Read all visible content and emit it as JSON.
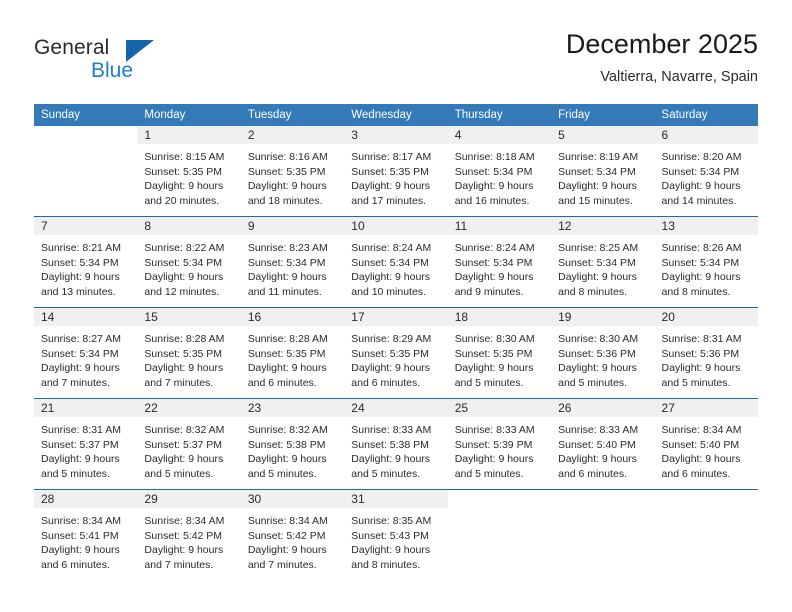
{
  "brand": {
    "name_part1": "General",
    "name_part2": "Blue",
    "logo_icon": "triangle-icon"
  },
  "header": {
    "title": "December 2025",
    "subtitle": "Valtierra, Navarre, Spain"
  },
  "colors": {
    "header_blue": "#3479b8",
    "separator_blue": "#1f69ad",
    "daynum_band": "#f0f0f0",
    "brand_blue": "#1a7fd4",
    "logo_blue": "#1465ab"
  },
  "weekday_headers": [
    "Sunday",
    "Monday",
    "Tuesday",
    "Wednesday",
    "Thursday",
    "Friday",
    "Saturday"
  ],
  "weeks": [
    [
      {
        "day": "",
        "lines": []
      },
      {
        "day": "1",
        "lines": [
          "Sunrise: 8:15 AM",
          "Sunset: 5:35 PM",
          "Daylight: 9 hours",
          "and 20 minutes."
        ]
      },
      {
        "day": "2",
        "lines": [
          "Sunrise: 8:16 AM",
          "Sunset: 5:35 PM",
          "Daylight: 9 hours",
          "and 18 minutes."
        ]
      },
      {
        "day": "3",
        "lines": [
          "Sunrise: 8:17 AM",
          "Sunset: 5:35 PM",
          "Daylight: 9 hours",
          "and 17 minutes."
        ]
      },
      {
        "day": "4",
        "lines": [
          "Sunrise: 8:18 AM",
          "Sunset: 5:34 PM",
          "Daylight: 9 hours",
          "and 16 minutes."
        ]
      },
      {
        "day": "5",
        "lines": [
          "Sunrise: 8:19 AM",
          "Sunset: 5:34 PM",
          "Daylight: 9 hours",
          "and 15 minutes."
        ]
      },
      {
        "day": "6",
        "lines": [
          "Sunrise: 8:20 AM",
          "Sunset: 5:34 PM",
          "Daylight: 9 hours",
          "and 14 minutes."
        ]
      }
    ],
    [
      {
        "day": "7",
        "lines": [
          "Sunrise: 8:21 AM",
          "Sunset: 5:34 PM",
          "Daylight: 9 hours",
          "and 13 minutes."
        ]
      },
      {
        "day": "8",
        "lines": [
          "Sunrise: 8:22 AM",
          "Sunset: 5:34 PM",
          "Daylight: 9 hours",
          "and 12 minutes."
        ]
      },
      {
        "day": "9",
        "lines": [
          "Sunrise: 8:23 AM",
          "Sunset: 5:34 PM",
          "Daylight: 9 hours",
          "and 11 minutes."
        ]
      },
      {
        "day": "10",
        "lines": [
          "Sunrise: 8:24 AM",
          "Sunset: 5:34 PM",
          "Daylight: 9 hours",
          "and 10 minutes."
        ]
      },
      {
        "day": "11",
        "lines": [
          "Sunrise: 8:24 AM",
          "Sunset: 5:34 PM",
          "Daylight: 9 hours",
          "and 9 minutes."
        ]
      },
      {
        "day": "12",
        "lines": [
          "Sunrise: 8:25 AM",
          "Sunset: 5:34 PM",
          "Daylight: 9 hours",
          "and 8 minutes."
        ]
      },
      {
        "day": "13",
        "lines": [
          "Sunrise: 8:26 AM",
          "Sunset: 5:34 PM",
          "Daylight: 9 hours",
          "and 8 minutes."
        ]
      }
    ],
    [
      {
        "day": "14",
        "lines": [
          "Sunrise: 8:27 AM",
          "Sunset: 5:34 PM",
          "Daylight: 9 hours",
          "and 7 minutes."
        ]
      },
      {
        "day": "15",
        "lines": [
          "Sunrise: 8:28 AM",
          "Sunset: 5:35 PM",
          "Daylight: 9 hours",
          "and 7 minutes."
        ]
      },
      {
        "day": "16",
        "lines": [
          "Sunrise: 8:28 AM",
          "Sunset: 5:35 PM",
          "Daylight: 9 hours",
          "and 6 minutes."
        ]
      },
      {
        "day": "17",
        "lines": [
          "Sunrise: 8:29 AM",
          "Sunset: 5:35 PM",
          "Daylight: 9 hours",
          "and 6 minutes."
        ]
      },
      {
        "day": "18",
        "lines": [
          "Sunrise: 8:30 AM",
          "Sunset: 5:35 PM",
          "Daylight: 9 hours",
          "and 5 minutes."
        ]
      },
      {
        "day": "19",
        "lines": [
          "Sunrise: 8:30 AM",
          "Sunset: 5:36 PM",
          "Daylight: 9 hours",
          "and 5 minutes."
        ]
      },
      {
        "day": "20",
        "lines": [
          "Sunrise: 8:31 AM",
          "Sunset: 5:36 PM",
          "Daylight: 9 hours",
          "and 5 minutes."
        ]
      }
    ],
    [
      {
        "day": "21",
        "lines": [
          "Sunrise: 8:31 AM",
          "Sunset: 5:37 PM",
          "Daylight: 9 hours",
          "and 5 minutes."
        ]
      },
      {
        "day": "22",
        "lines": [
          "Sunrise: 8:32 AM",
          "Sunset: 5:37 PM",
          "Daylight: 9 hours",
          "and 5 minutes."
        ]
      },
      {
        "day": "23",
        "lines": [
          "Sunrise: 8:32 AM",
          "Sunset: 5:38 PM",
          "Daylight: 9 hours",
          "and 5 minutes."
        ]
      },
      {
        "day": "24",
        "lines": [
          "Sunrise: 8:33 AM",
          "Sunset: 5:38 PM",
          "Daylight: 9 hours",
          "and 5 minutes."
        ]
      },
      {
        "day": "25",
        "lines": [
          "Sunrise: 8:33 AM",
          "Sunset: 5:39 PM",
          "Daylight: 9 hours",
          "and 5 minutes."
        ]
      },
      {
        "day": "26",
        "lines": [
          "Sunrise: 8:33 AM",
          "Sunset: 5:40 PM",
          "Daylight: 9 hours",
          "and 6 minutes."
        ]
      },
      {
        "day": "27",
        "lines": [
          "Sunrise: 8:34 AM",
          "Sunset: 5:40 PM",
          "Daylight: 9 hours",
          "and 6 minutes."
        ]
      }
    ],
    [
      {
        "day": "28",
        "lines": [
          "Sunrise: 8:34 AM",
          "Sunset: 5:41 PM",
          "Daylight: 9 hours",
          "and 6 minutes."
        ]
      },
      {
        "day": "29",
        "lines": [
          "Sunrise: 8:34 AM",
          "Sunset: 5:42 PM",
          "Daylight: 9 hours",
          "and 7 minutes."
        ]
      },
      {
        "day": "30",
        "lines": [
          "Sunrise: 8:34 AM",
          "Sunset: 5:42 PM",
          "Daylight: 9 hours",
          "and 7 minutes."
        ]
      },
      {
        "day": "31",
        "lines": [
          "Sunrise: 8:35 AM",
          "Sunset: 5:43 PM",
          "Daylight: 9 hours",
          "and 8 minutes."
        ]
      },
      {
        "day": "",
        "lines": []
      },
      {
        "day": "",
        "lines": []
      },
      {
        "day": "",
        "lines": []
      }
    ]
  ]
}
